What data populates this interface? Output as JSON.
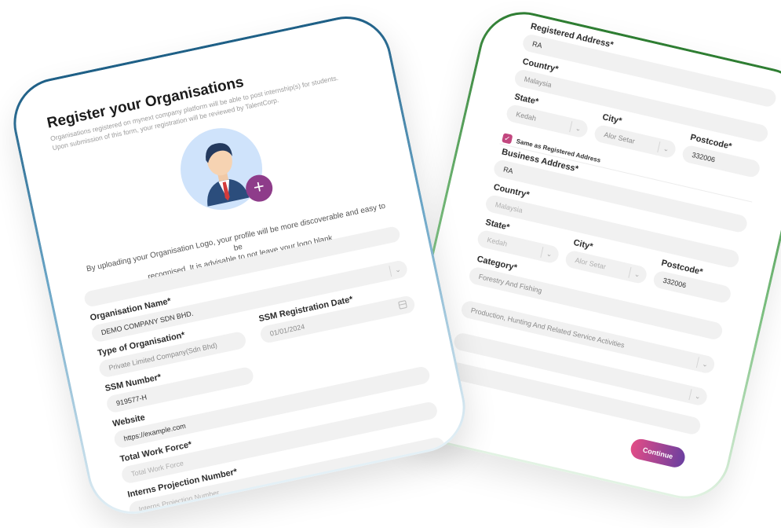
{
  "left_card": {
    "title": "Register your Organisations",
    "subtitle_line1": "Organisations registered on mynext company platform will be able to post internship(s) for students.",
    "subtitle_line2": "Upon submission of this form, your registration will be reviewed by TalentCorp.",
    "logo_note_line1": "By uploading your Organisation Logo, your profile will be more discoverable and easy to be",
    "logo_note_line2": "recognised. It is advisable to not leave your logo blank",
    "add_logo_symbol": "+",
    "fields": {
      "organisation_name": {
        "label": "Organisation Name*",
        "value": "DEMO COMPANY SDN BHD."
      },
      "type_of_organisation": {
        "label": "Type of Organisation*",
        "value": "Private Limited Company(Sdn Bhd)"
      },
      "ssm_number": {
        "label": "SSM Number*",
        "value": "919577-H"
      },
      "ssm_registration_date": {
        "label": "SSM Registration Date*",
        "value": "01/01/2024"
      },
      "website": {
        "label": "Website",
        "value": "https://example.com"
      },
      "total_work_force": {
        "label": "Total Work Force*",
        "placeholder": "Total Work Force"
      },
      "interns_projection_number": {
        "label": "Interns Projection Number*",
        "placeholder": "Interns Projection Number"
      }
    },
    "border_color": "#1e5f86"
  },
  "right_card": {
    "registered_address": {
      "label": "Registered Address*",
      "value": "RA"
    },
    "country": {
      "label": "Country*",
      "value": "Malaysia"
    },
    "state": {
      "label": "State*",
      "value": "Kedah"
    },
    "city": {
      "label": "City*",
      "value": "Alor Setar"
    },
    "postcode": {
      "label": "Postcode*",
      "value": "332006"
    },
    "same_as_registered": {
      "label": "Same as Registered Address",
      "checked": true
    },
    "business_address": {
      "label": "Business Address*",
      "value": "RA"
    },
    "business_country": {
      "label": "Country*",
      "value": "Malaysia"
    },
    "business_state": {
      "label": "State*",
      "value": "Kedah"
    },
    "business_city": {
      "label": "City*",
      "value": "Alor Setar"
    },
    "business_postcode": {
      "label": "Postcode*",
      "value": "332006"
    },
    "category": {
      "label": "Category*",
      "value": "Forestry And Fishing"
    },
    "subcategory": {
      "value": "Production, Hunting And Related Service Activities"
    },
    "continue_label": "Continue",
    "border_color": "#2e7d32",
    "accent_color": "#c2477f"
  }
}
